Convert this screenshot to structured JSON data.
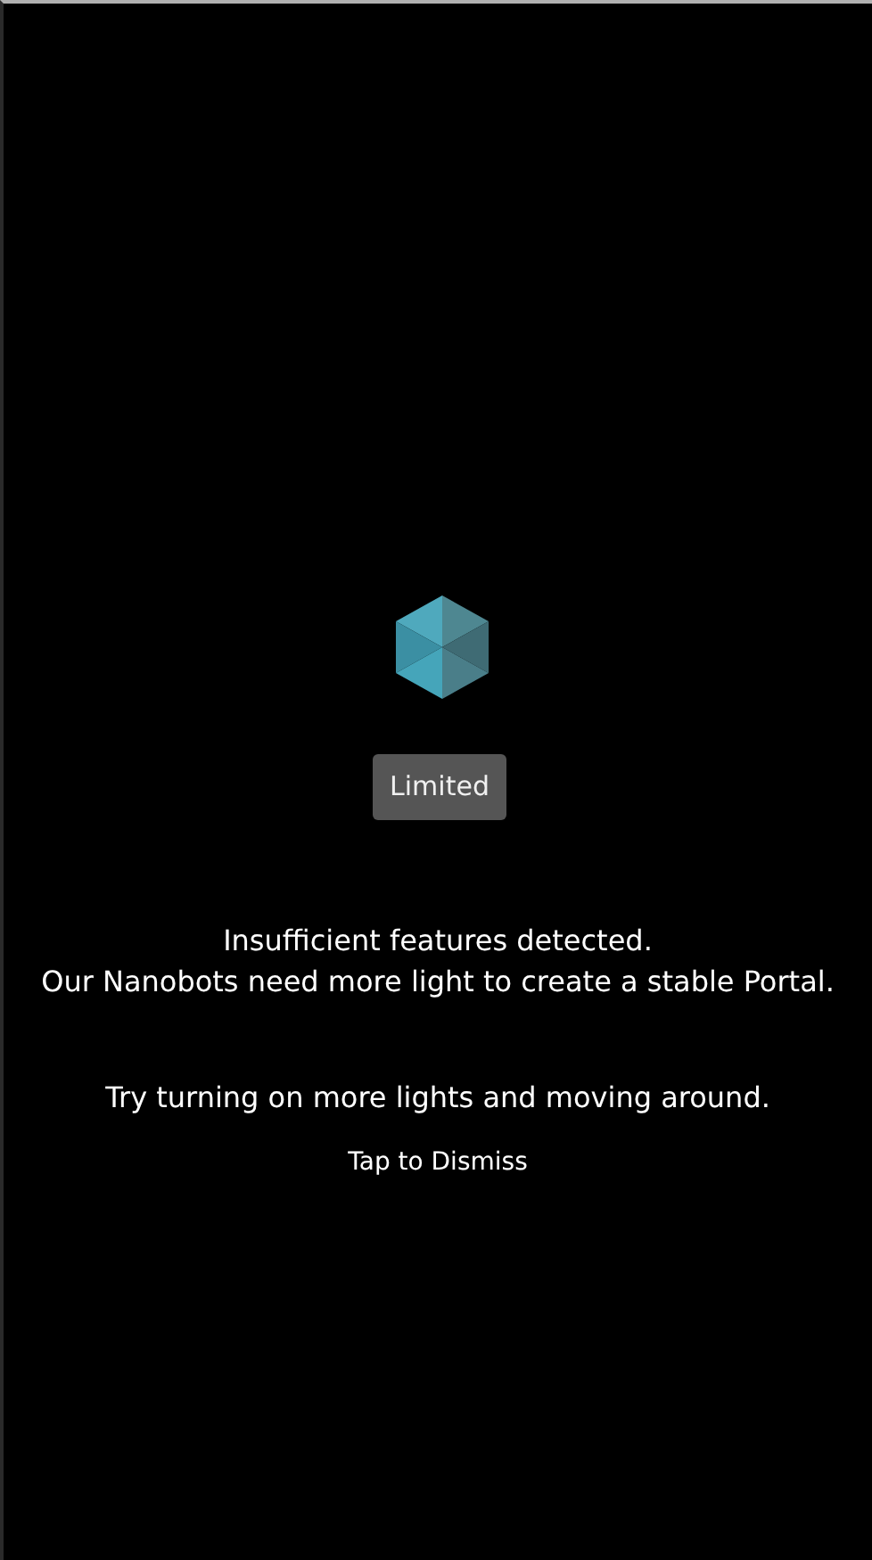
{
  "status_badge": "Limited",
  "message": [
    "Insufficient features detected.",
    "Our Nanobots need more light to create a stable Portal."
  ],
  "hint": "Try turning on more lights and moving around.",
  "dismiss": "Tap to Dismiss"
}
